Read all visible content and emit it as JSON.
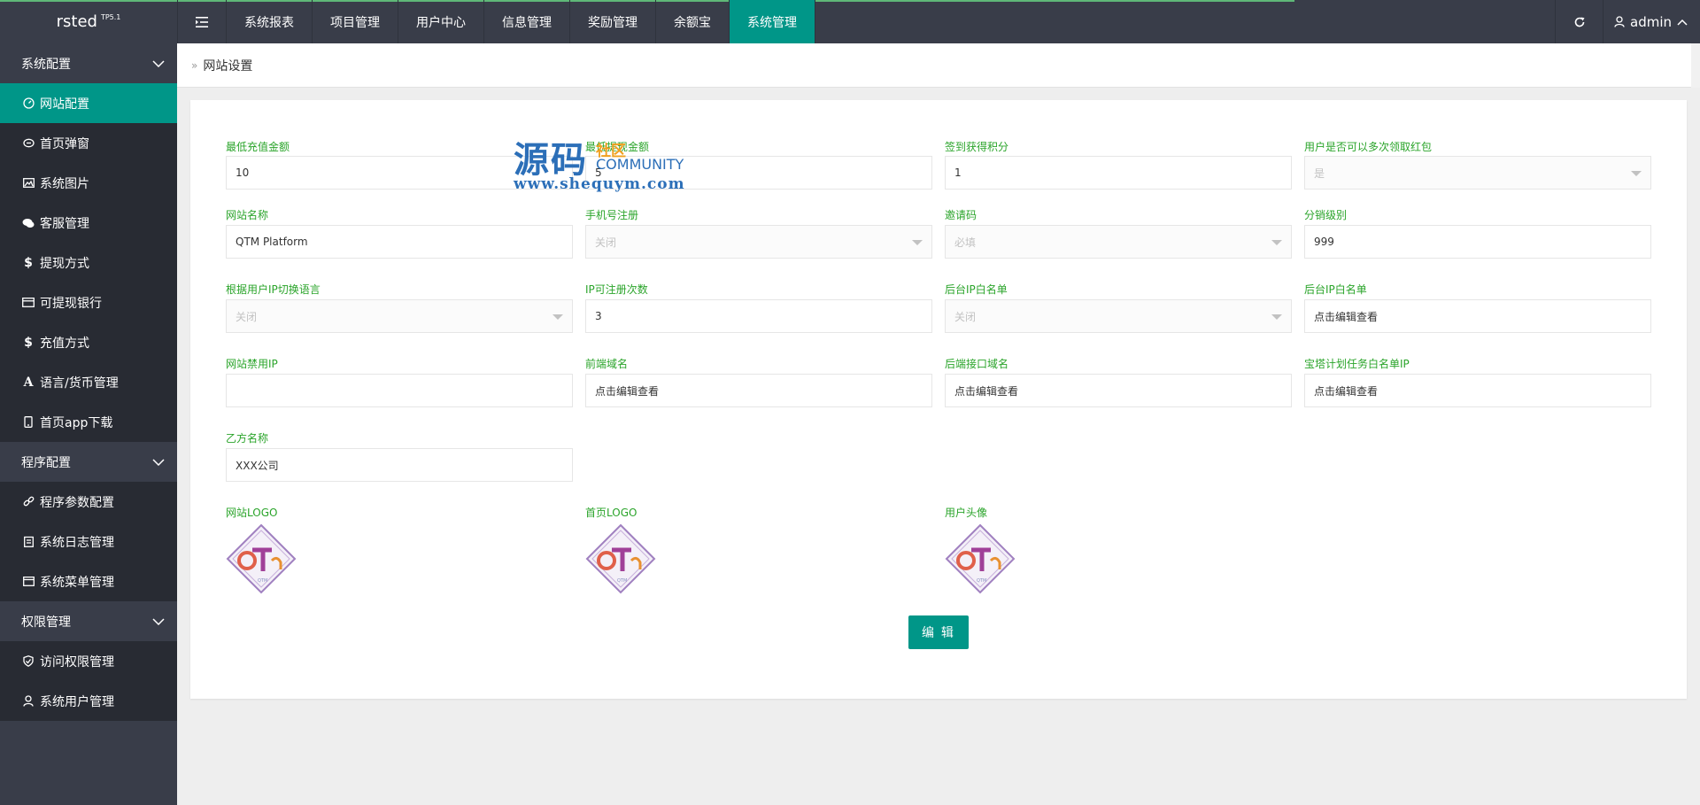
{
  "app": {
    "brand": "rsted",
    "brand_version": "TP5.1"
  },
  "topnav": {
    "items": [
      {
        "label": "系统报表"
      },
      {
        "label": "项目管理"
      },
      {
        "label": "用户中心"
      },
      {
        "label": "信息管理"
      },
      {
        "label": "奖励管理"
      },
      {
        "label": "余额宝"
      },
      {
        "label": "系统管理",
        "active": true
      }
    ],
    "user": "admin"
  },
  "sidebar": {
    "groups": [
      {
        "label": "系统配置",
        "items": [
          {
            "label": "网站配置",
            "icon": "gauge-icon",
            "active": true
          },
          {
            "label": "首页弹窗",
            "icon": "chat-bubble-icon"
          },
          {
            "label": "系统图片",
            "icon": "image-icon"
          },
          {
            "label": "客服管理",
            "icon": "comments-icon"
          },
          {
            "label": "提现方式",
            "icon": "dollar-icon"
          },
          {
            "label": "可提现银行",
            "icon": "credit-card-icon"
          },
          {
            "label": "充值方式",
            "icon": "dollar-icon"
          },
          {
            "label": "语言/货币管理",
            "icon": "font-icon"
          },
          {
            "label": "首页app下载",
            "icon": "mobile-icon"
          }
        ]
      },
      {
        "label": "程序配置",
        "items": [
          {
            "label": "程序参数配置",
            "icon": "link-icon"
          },
          {
            "label": "系统日志管理",
            "icon": "clipboard-icon"
          },
          {
            "label": "系统菜单管理",
            "icon": "window-icon"
          }
        ]
      },
      {
        "label": "权限管理",
        "items": [
          {
            "label": "访问权限管理",
            "icon": "shield-check-icon"
          },
          {
            "label": "系统用户管理",
            "icon": "user-icon"
          }
        ]
      }
    ]
  },
  "breadcrumb": {
    "title": "网站设置"
  },
  "form": {
    "fields": [
      {
        "label": "最低充值金额",
        "value": "10",
        "type": "text"
      },
      {
        "label": "最低提现金额",
        "value": "5",
        "type": "text"
      },
      {
        "label": "签到获得积分",
        "value": "1",
        "type": "text"
      },
      {
        "label": "用户是否可以多次领取红包",
        "value": "是",
        "type": "select"
      },
      {
        "label": "网站名称",
        "value": "QTM Platform",
        "type": "text"
      },
      {
        "label": "手机号注册",
        "value": "关闭",
        "type": "select"
      },
      {
        "label": "邀请码",
        "value": "必填",
        "type": "select"
      },
      {
        "label": "分销级别",
        "value": "999",
        "type": "text"
      },
      {
        "label": "根据用户IP切换语言",
        "value": "关闭",
        "type": "select"
      },
      {
        "label": "IP可注册次数",
        "value": "3",
        "type": "text"
      },
      {
        "label": "后台IP白名单",
        "value": "关闭",
        "type": "select"
      },
      {
        "label": "后台IP白名单",
        "value": "点击编辑查看",
        "type": "text"
      },
      {
        "label": "网站禁用IP",
        "value": "",
        "type": "text"
      },
      {
        "label": "前端域名",
        "value": "点击编辑查看",
        "type": "text"
      },
      {
        "label": "后端接口域名",
        "value": "点击编辑查看",
        "type": "text"
      },
      {
        "label": "宝塔计划任务白名单IP",
        "value": "点击编辑查看",
        "type": "text"
      },
      {
        "label": "乙方名称",
        "value": "XXX公司",
        "type": "text"
      }
    ],
    "images": [
      {
        "label": "网站LOGO"
      },
      {
        "label": "首页LOGO"
      },
      {
        "label": "用户头像"
      }
    ],
    "edit_label": "编 辑"
  },
  "watermark": {
    "big": "源码",
    "small": "社区",
    "community": "COMMUNITY",
    "url": "www.shequym.com"
  },
  "colors": {
    "accent": "#009688",
    "label_green": "#2aa42a",
    "topbar": "#393d49",
    "sidebar_sub": "#282b33"
  }
}
